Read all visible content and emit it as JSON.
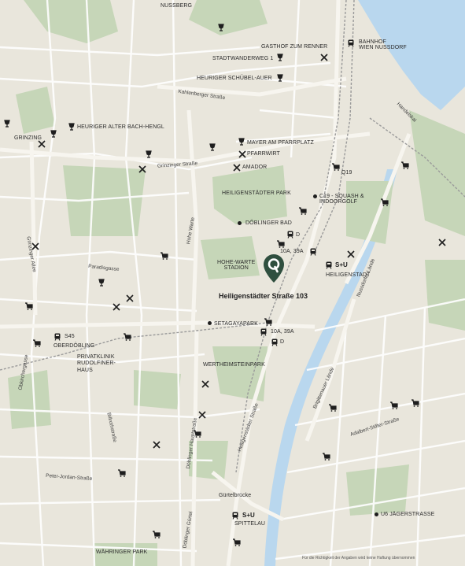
{
  "colors": {
    "background": "#e9e6dc",
    "park": "#c6d6b8",
    "water": "#b9d7ee",
    "road": "#ffffff",
    "railway": "#a8a8a8",
    "marker": "#2f4f3f"
  },
  "places": {
    "nussberg": "NUSSBERG",
    "gasthof": "GASTHOF ZUM RENNER",
    "bahnhof": "BAHNHOF\nWIEN NUSSDORF",
    "stadtwanderweg": "STADTWANDERWEG 1",
    "schuebel": "HEURIGER SCHÜBEL-AUER",
    "grinzing": "GRINZING",
    "bachhengl": "HEURIGER ALTER BACH-HENGL",
    "mayer": "MAYER AM PFARRPLATZ",
    "pfarrwirt": "PFARRWIRT",
    "amador": "AMADOR",
    "q19": "Q19",
    "heiligenstaedter_park": "HEILIGENSTÄDTER PARK",
    "c19": "C19 - SQUASH &\nINDOORGOLF",
    "doeblinger_bad": "DÖBLINGER BAD",
    "hohe_warte": "HOHE-WARTE\nSTADION",
    "heiligenstadt": "HEILIGENSTADT",
    "setagayapark": "SETAGAYAPARK",
    "oberdoebling": "OBERDÖBLING",
    "privatklinik": "PRIVATKLINIK\nRUDOLFINER-\nHAUS",
    "wertheimsteinpark": "WERTHEIMSTEINPARK",
    "spittelau": "SPITTELAU",
    "u6": "U6 JÄGERSTRASSE",
    "waehringer_park": "WÄHRINGER PARK",
    "guertelbruecke": "Gürtelbrücke"
  },
  "transit": {
    "d_top": "D",
    "bus_top": "10A, 39A",
    "su_heiligenstadt": "S+U",
    "bus_mid": "10A, 39A",
    "d_mid": "D",
    "s45": "S45",
    "su_spittelau": "S+U"
  },
  "streets": {
    "kahlenberger": "Kahlenberger Straße",
    "grinzinger": "Grinzinger Straße",
    "hohe_warte": "Hohe Warte",
    "grinzinger_allee": "Grinzinger Allee",
    "paradisgasse": "Paradisgasse",
    "nussdorfer_laende": "Nussdorfer Lände",
    "heiligenstaedter_str": "Heiligenstädter Straße",
    "brigittenauer": "Brigittenauer Lände",
    "adalbert": "Adalbert-Stifter-Straße",
    "billroth": "Billrothstraße",
    "doeblinger_haupt": "Döblinger Hauptstraße",
    "peter_jordan": "Peter-Jordan-Straße",
    "obkirchergasse": "Obkirchergasse",
    "doeblinger_guertel": "Döblinger Gürtel",
    "handelskai": "Handelskai"
  },
  "marker": {
    "title": "Heiligenstädter Straße 103",
    "icon": "location-pin-icon"
  },
  "footer_note": "Für die Richtigkeit der Angaben wird keine Haftung übernommen"
}
